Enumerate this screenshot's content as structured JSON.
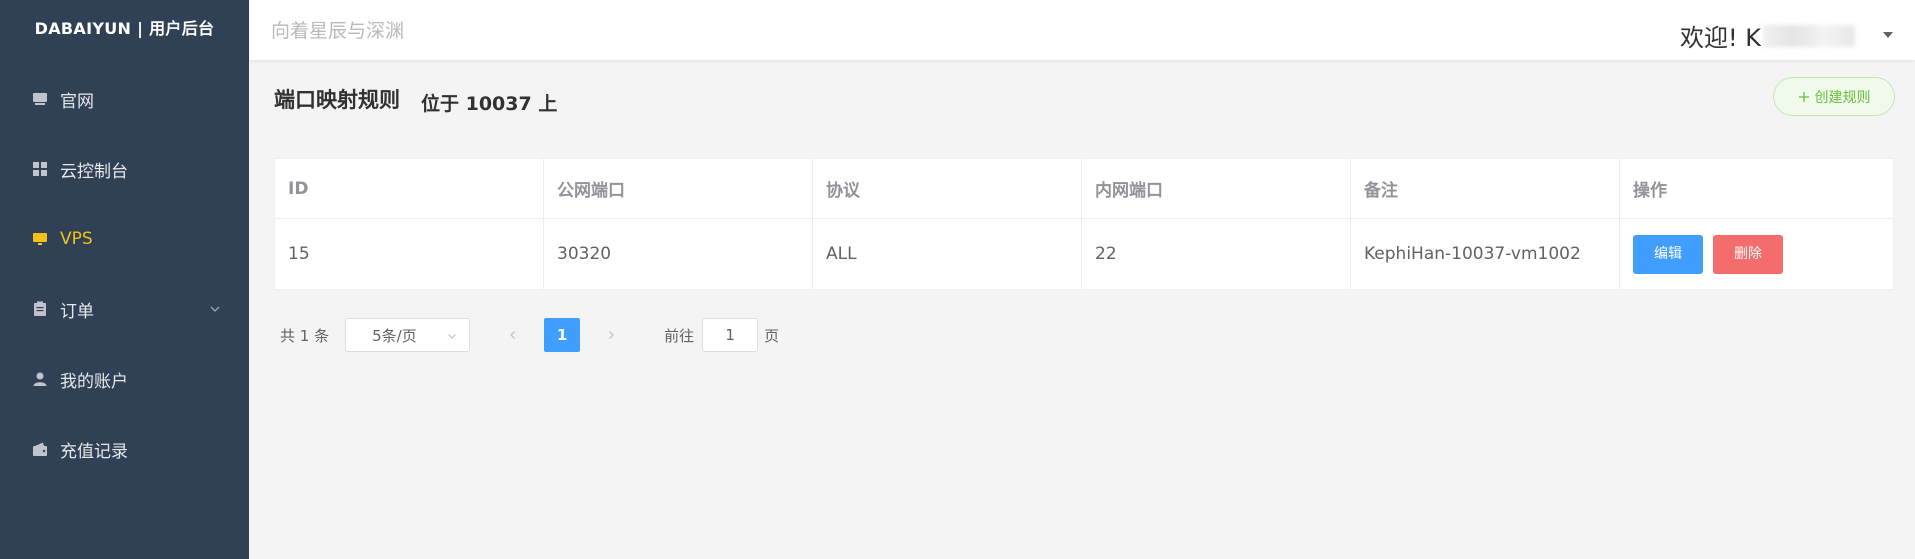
{
  "sidebar": {
    "brand": "DABAIYUN | 用户后台",
    "items": [
      {
        "label": "官网",
        "icon": "monitor-icon"
      },
      {
        "label": "云控制台",
        "icon": "grid-icon"
      },
      {
        "label": "VPS",
        "icon": "screen-icon",
        "active": true
      },
      {
        "label": "订单",
        "icon": "clipboard-icon"
      },
      {
        "label": "我的账户",
        "icon": "user-icon"
      },
      {
        "label": "充值记录",
        "icon": "wallet-icon"
      }
    ]
  },
  "header": {
    "slogan": "向着星辰与深渊",
    "welcome": "欢迎! K"
  },
  "page": {
    "title": "端口映射规则",
    "subtitle": "位于 10037 上",
    "create_button": "创建规则"
  },
  "table": {
    "columns": [
      "ID",
      "公网端口",
      "协议",
      "内网端口",
      "备注",
      "操作"
    ],
    "rows": [
      {
        "id": "15",
        "public_port": "30320",
        "protocol": "ALL",
        "internal_port": "22",
        "note": "KephiHan-10037-vm1002",
        "edit": "编辑",
        "delete": "删除"
      }
    ]
  },
  "pagination": {
    "total": "共 1 条",
    "page_size": "5条/页",
    "current_page": "1",
    "goto_label": "前往",
    "goto_value": "1",
    "page_suffix": "页"
  },
  "colors": {
    "sidebar_bg": "#304156",
    "active": "#f1c21b",
    "primary": "#409eff",
    "danger": "#f56c6c",
    "success": "#67c23a"
  }
}
